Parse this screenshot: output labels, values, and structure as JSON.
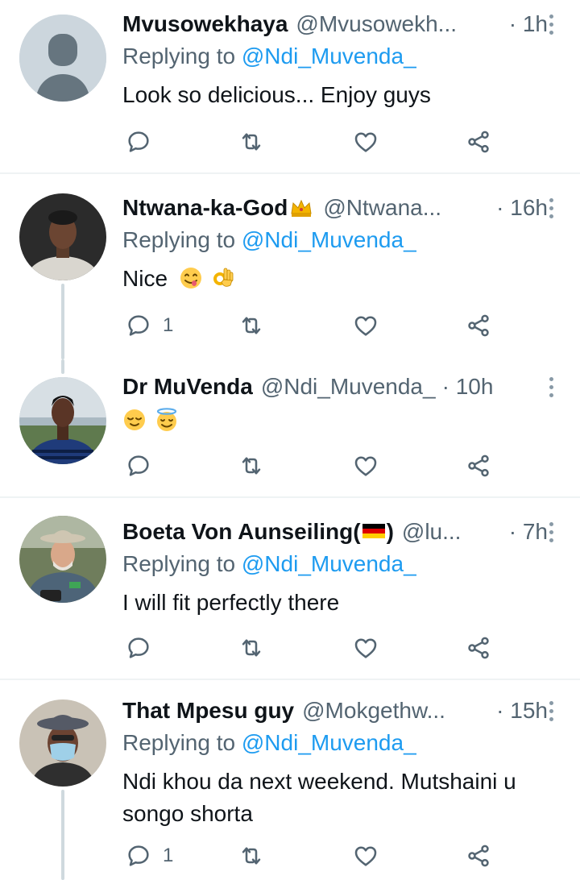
{
  "tweets": [
    {
      "name": "Mvusowekhaya",
      "handle": "@Mvusowekh...",
      "time": "· 1h",
      "replying_label": "Replying to",
      "replying_to": "@Ndi_Muvenda_",
      "text": "Look so delicious... Enjoy guys",
      "avatar": "default-avatar",
      "reply_count": ""
    },
    {
      "name": "Ntwana-ka-God",
      "name_emoji": "crown-emoji",
      "handle": "@Ntwana...",
      "time": "· 16h",
      "replying_label": "Replying to",
      "replying_to": "@Ndi_Muvenda_",
      "text": "Nice",
      "text_emojis": [
        "face-savoring-food-emoji",
        "ok-hand-emoji"
      ],
      "avatar": "user-photo",
      "reply_count": "1"
    },
    {
      "name": "Dr MuVenda",
      "handle": "@Ndi_Muvenda_",
      "time": "· 10h",
      "text_emojis": [
        "relieved-face-emoji",
        "smiling-face-with-halo-emoji"
      ],
      "avatar": "user-photo",
      "reply_count": ""
    },
    {
      "name": "Boeta Von Aunseiling(",
      "name_suffix": ")",
      "name_emoji": "germany-flag-emoji",
      "handle": "@lu...",
      "time": "· 7h",
      "replying_label": "Replying to",
      "replying_to": "@Ndi_Muvenda_",
      "text": "I will fit perfectly there",
      "avatar": "user-photo",
      "reply_count": ""
    },
    {
      "name": "That Mpesu guy",
      "handle": "@Mokgethw...",
      "time": "· 15h",
      "replying_label": "Replying to",
      "replying_to": "@Ndi_Muvenda_",
      "text": "Ndi khou da next weekend. Mutshaini u songo shorta",
      "avatar": "user-photo",
      "reply_count": "1"
    }
  ],
  "colors": {
    "text": "#0f1419",
    "secondary": "#536471",
    "link": "#1d9bf0",
    "divider": "#eff3f4",
    "thread_line": "#cfd9de"
  }
}
